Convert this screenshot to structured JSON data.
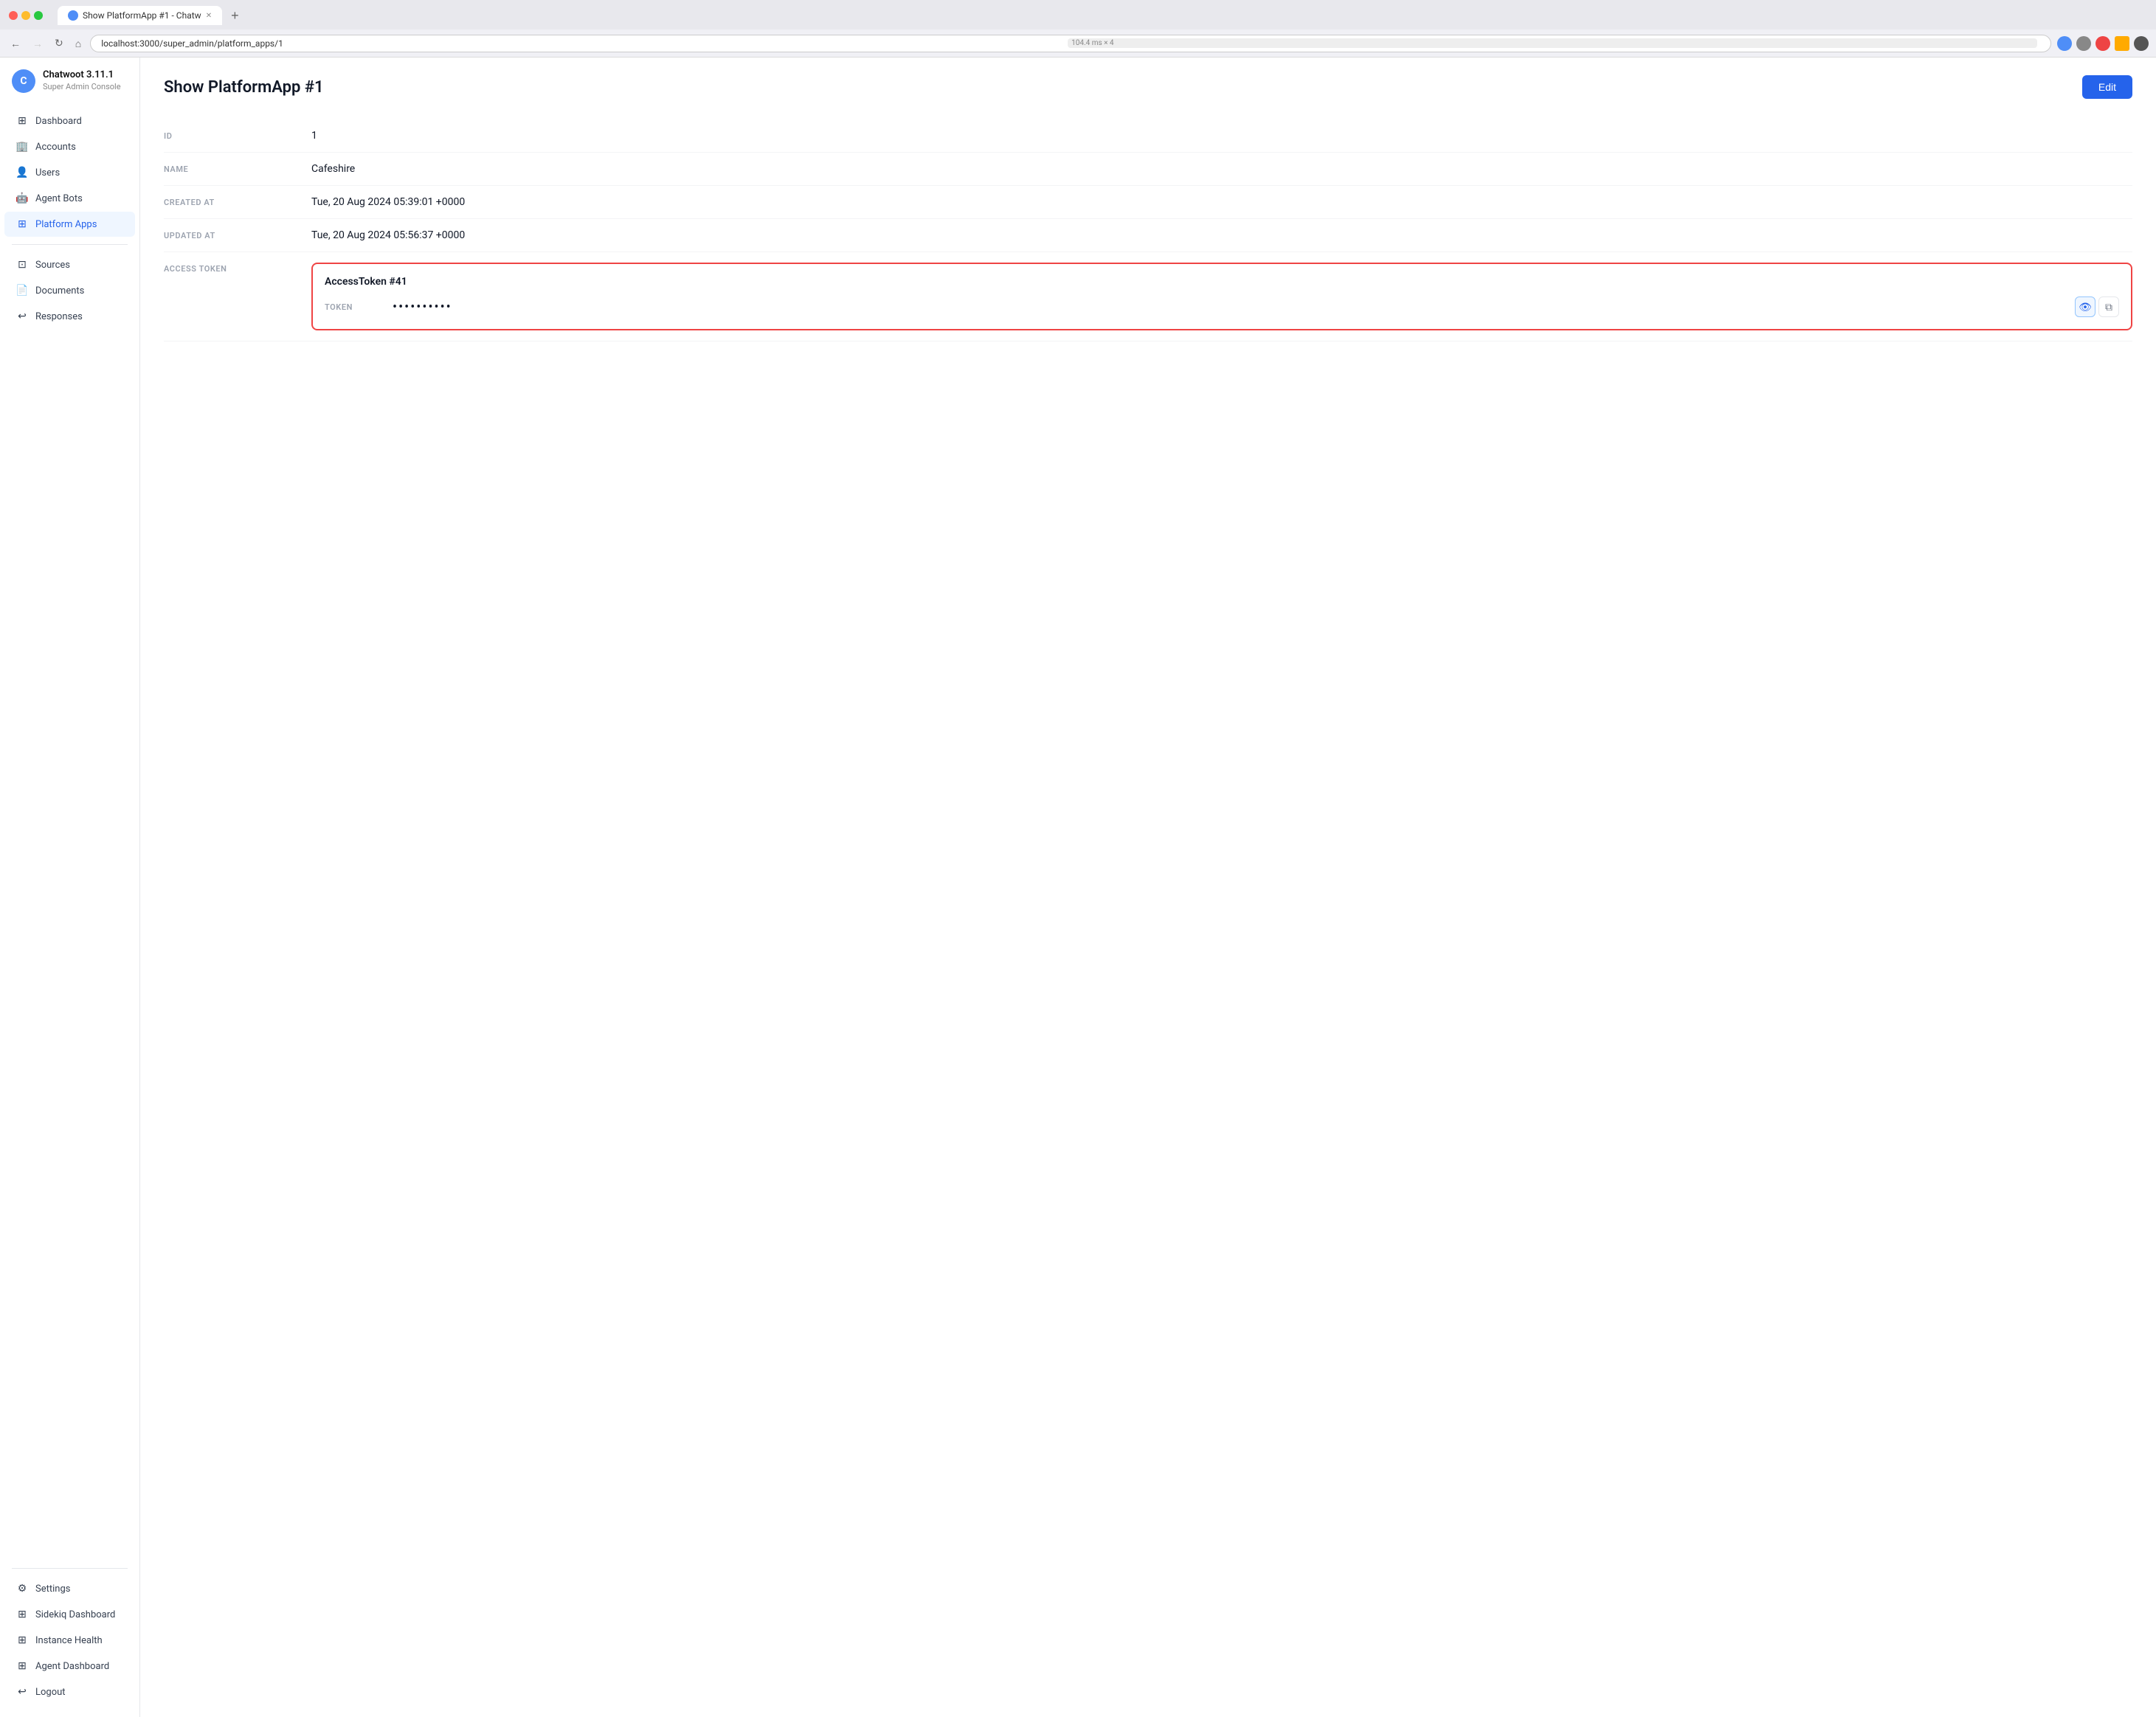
{
  "browser": {
    "perf": "104.4 ms × 4",
    "url": "localhost:3000/super_admin/platform_apps/1",
    "tab_title": "Show PlatformApp #1 - Chatw",
    "new_tab_label": "+"
  },
  "sidebar": {
    "brand_initial": "C",
    "brand_name": "Chatwoot 3.11.1",
    "brand_sub": "Super Admin Console",
    "nav_items": [
      {
        "key": "dashboard",
        "label": "Dashboard",
        "icon": "⊞"
      },
      {
        "key": "accounts",
        "label": "Accounts",
        "icon": "🏢"
      },
      {
        "key": "users",
        "label": "Users",
        "icon": "👤"
      },
      {
        "key": "agent-bots",
        "label": "Agent Bots",
        "icon": "🤖"
      },
      {
        "key": "platform-apps",
        "label": "Platform Apps",
        "icon": "⊞",
        "active": true
      }
    ],
    "secondary_items": [
      {
        "key": "sources",
        "label": "Sources",
        "icon": "⊡"
      },
      {
        "key": "documents",
        "label": "Documents",
        "icon": "📄"
      },
      {
        "key": "responses",
        "label": "Responses",
        "icon": "↩"
      }
    ],
    "bottom_items": [
      {
        "key": "settings",
        "label": "Settings",
        "icon": "⚙"
      },
      {
        "key": "sidekiq",
        "label": "Sidekiq Dashboard",
        "icon": "⊞"
      },
      {
        "key": "instance-health",
        "label": "Instance Health",
        "icon": "⊞"
      },
      {
        "key": "agent-dashboard",
        "label": "Agent Dashboard",
        "icon": "⊞"
      },
      {
        "key": "logout",
        "label": "Logout",
        "icon": "↩"
      }
    ]
  },
  "page": {
    "title": "Show PlatformApp #1",
    "edit_btn": "Edit",
    "fields": [
      {
        "key": "id",
        "label": "ID",
        "value": "1"
      },
      {
        "key": "name",
        "label": "NAME",
        "value": "Cafeshire"
      },
      {
        "key": "created_at",
        "label": "CREATED AT",
        "value": "Tue, 20 Aug 2024 05:39:01 +0000"
      },
      {
        "key": "updated_at",
        "label": "UPDATED AT",
        "value": "Tue, 20 Aug 2024 05:56:37 +0000"
      }
    ],
    "access_token": {
      "label": "ACCESS TOKEN",
      "token_name": "AccessToken #41",
      "token_label": "TOKEN",
      "token_dots": "••••••••••",
      "show_icon": "👁",
      "copy_icon": "⧉"
    }
  }
}
